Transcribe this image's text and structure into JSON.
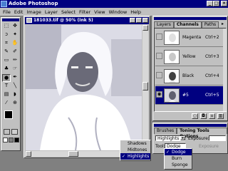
{
  "app": {
    "title": "Adobe Photoshop"
  },
  "menu": [
    "File",
    "Edit",
    "Image",
    "Layer",
    "Select",
    "Filter",
    "View",
    "Window",
    "Help"
  ],
  "document": {
    "title": "181033.tif @ 50% (Ink 5)"
  },
  "channels_panel": {
    "tabs": [
      "Layers",
      "Channels",
      "Paths"
    ],
    "rows": [
      {
        "name": "Magenta",
        "shortcut": "Ctrl+2"
      },
      {
        "name": "Yellow",
        "shortcut": "Ctrl+3"
      },
      {
        "name": "Black",
        "shortcut": "Ctrl+4"
      },
      {
        "name": "#5",
        "shortcut": "Ctrl+5"
      }
    ]
  },
  "toning_panel": {
    "tabs": [
      "Brushes",
      "Toning Tools Options"
    ],
    "range_value": "Highlights",
    "exposure_label": "Exposure:",
    "tool_label": "Tool:",
    "tool_value": "Dodge",
    "faded_label": "Exposure"
  },
  "range_menu": {
    "items": [
      "Shadows",
      "Midtones",
      "Highlights"
    ],
    "selected": "Highlights"
  },
  "tool_menu": {
    "items": [
      "Dodge",
      "Burn",
      "Sponge"
    ],
    "selected": "Dodge"
  }
}
